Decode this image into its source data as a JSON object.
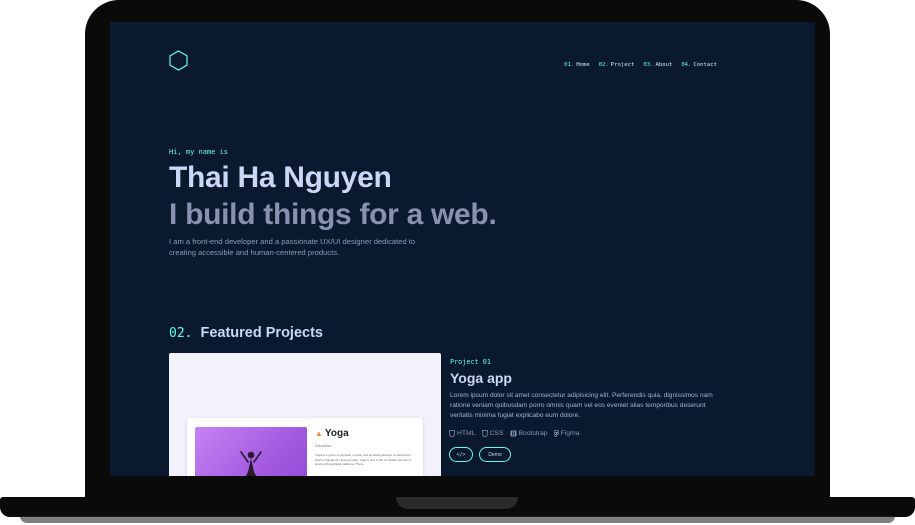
{
  "nav": {
    "items": [
      {
        "num": "01.",
        "label": "Home"
      },
      {
        "num": "02.",
        "label": "Project"
      },
      {
        "num": "03.",
        "label": "About"
      },
      {
        "num": "04.",
        "label": "Contact"
      }
    ]
  },
  "hero": {
    "greeting": "Hi, my name is",
    "name": "Thai Ha Nguyen",
    "tagline": "I build things for a web.",
    "intro": "I am a front-end developer and a passionate UX/UI designer dedicated to creating accessible and human-centered products."
  },
  "section": {
    "number": "02.",
    "title": "Featured Projects"
  },
  "project": {
    "label": "Project 01",
    "title": "Yoga app",
    "description": "Lorem ipsum dolor sit amet consectetur adipisicing elit. Perferendis quia, dignissimos nam ratione veniam quibusdam porro omnis quam vel eos eveniet alias temporibus deserunt veritatis minima fugiat explicabo eum dolore.",
    "tech": [
      "HTML",
      "CSS",
      "Bootstrap",
      "Figma"
    ],
    "code_label": "</>",
    "demo_label": "Demo",
    "preview": {
      "title": "Yoga",
      "subtitle": "Discipline",
      "text": "Yoga is a group of physical, mental, and spiritual practices or disciplines which originated in ancient India. Yoga is one of the six Āstika schools of Hindu philosophical traditions. There"
    }
  },
  "colors": {
    "background": "#0b192f",
    "accent": "#64ffda",
    "heading": "#ccd6f6",
    "muted": "#8892b0"
  },
  "icons": {
    "logo": "hexagon-logo-icon",
    "tech": [
      "html-icon",
      "css-icon",
      "bootstrap-icon",
      "figma-icon"
    ]
  }
}
